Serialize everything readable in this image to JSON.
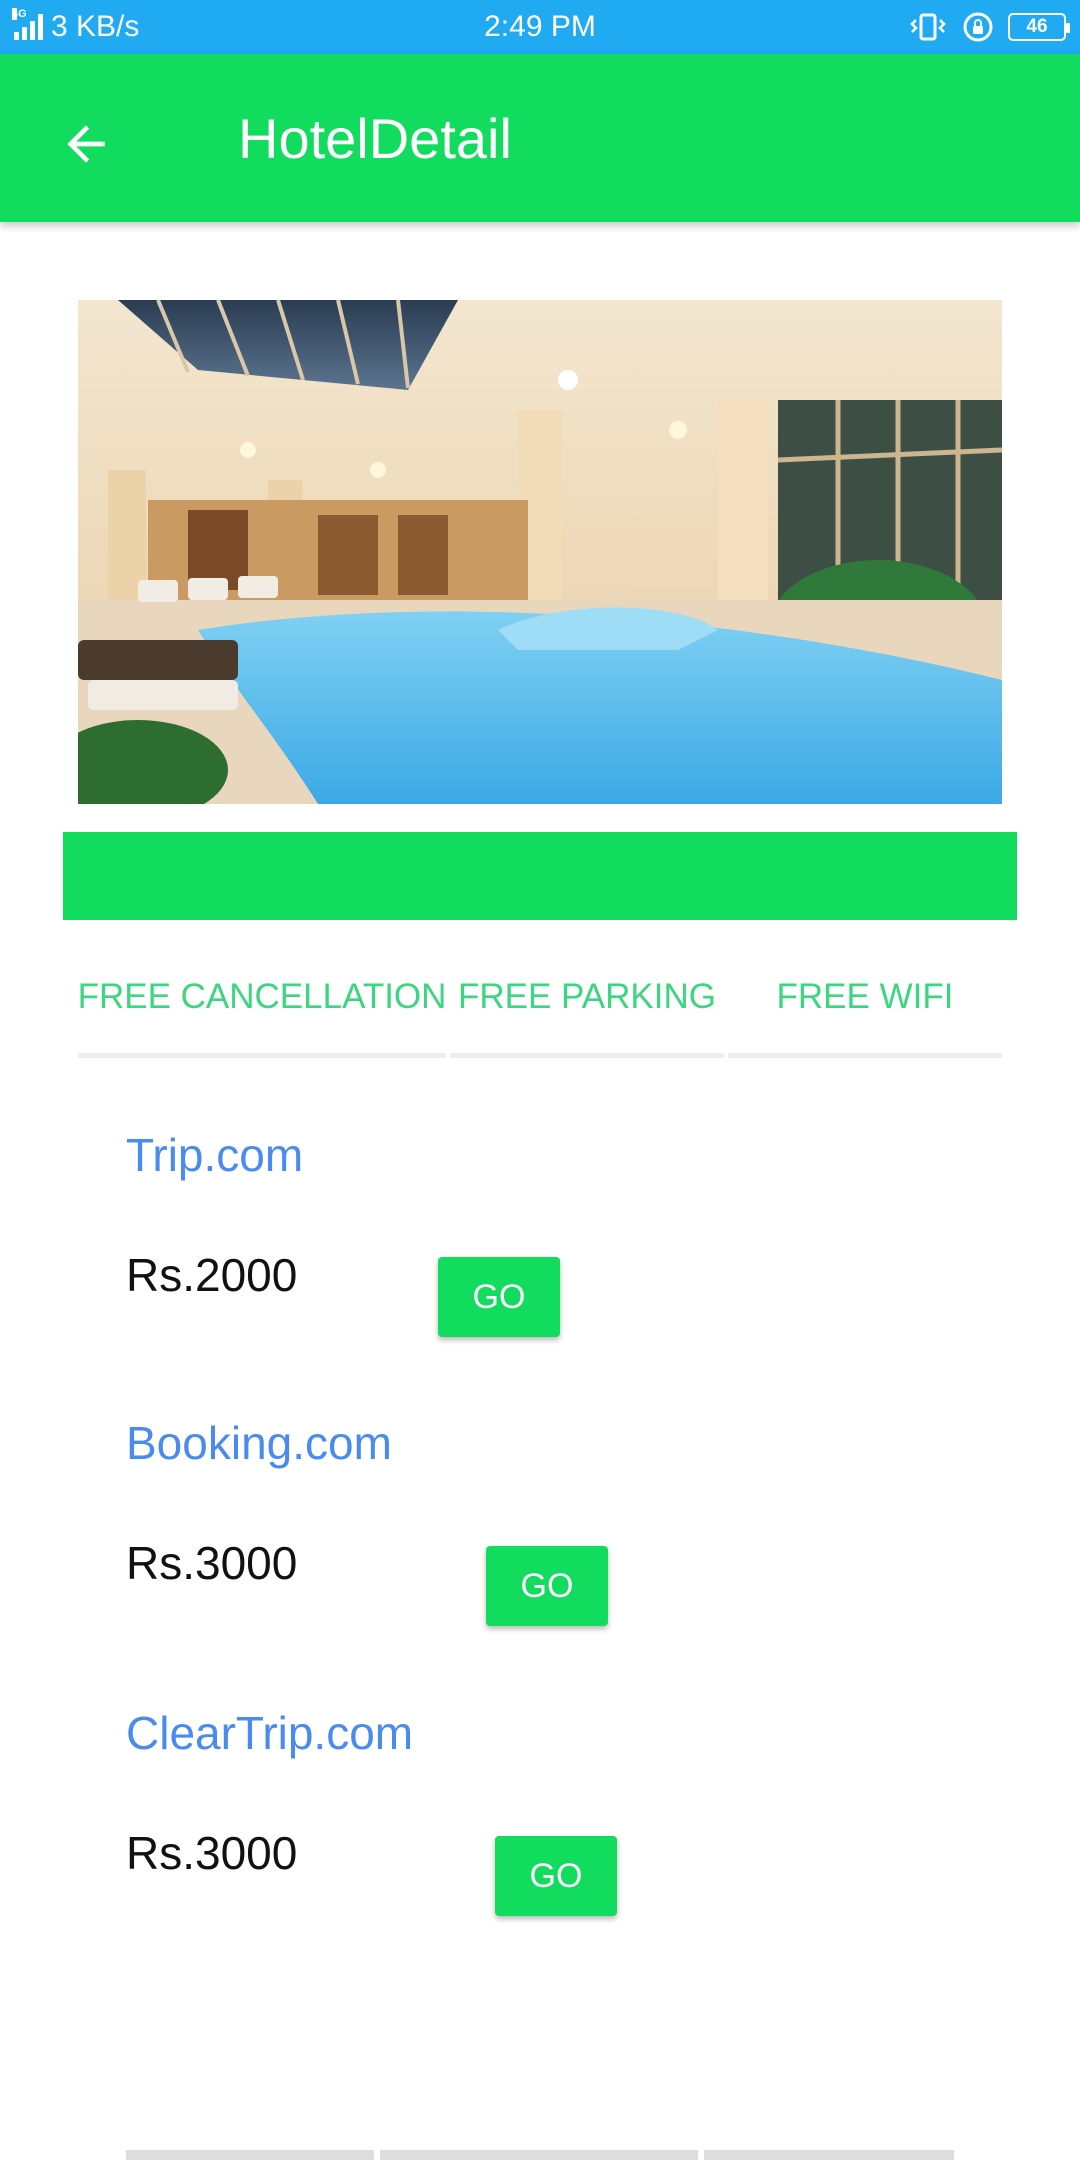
{
  "status_bar": {
    "network": "4G",
    "speed": "3 KB/s",
    "time": "2:49 PM",
    "battery": "46"
  },
  "app_bar": {
    "title": "HotelDetail",
    "back_icon": "arrow-left-icon"
  },
  "colors": {
    "primary": "#12dc5e",
    "status_bar": "#1faaf2",
    "link": "#4a8bef",
    "amenity_text": "#3bd67f"
  },
  "amenities": [
    "FREE CANCELLATION",
    "FREE PARKING",
    "FREE WIFI"
  ],
  "offers": [
    {
      "site": "Trip.com",
      "price": "Rs.2000",
      "button": "GO"
    },
    {
      "site": "Booking.com",
      "price": "Rs.3000",
      "button": "GO"
    },
    {
      "site": "ClearTrip.com",
      "price": "Rs.3000",
      "button": "GO"
    }
  ]
}
